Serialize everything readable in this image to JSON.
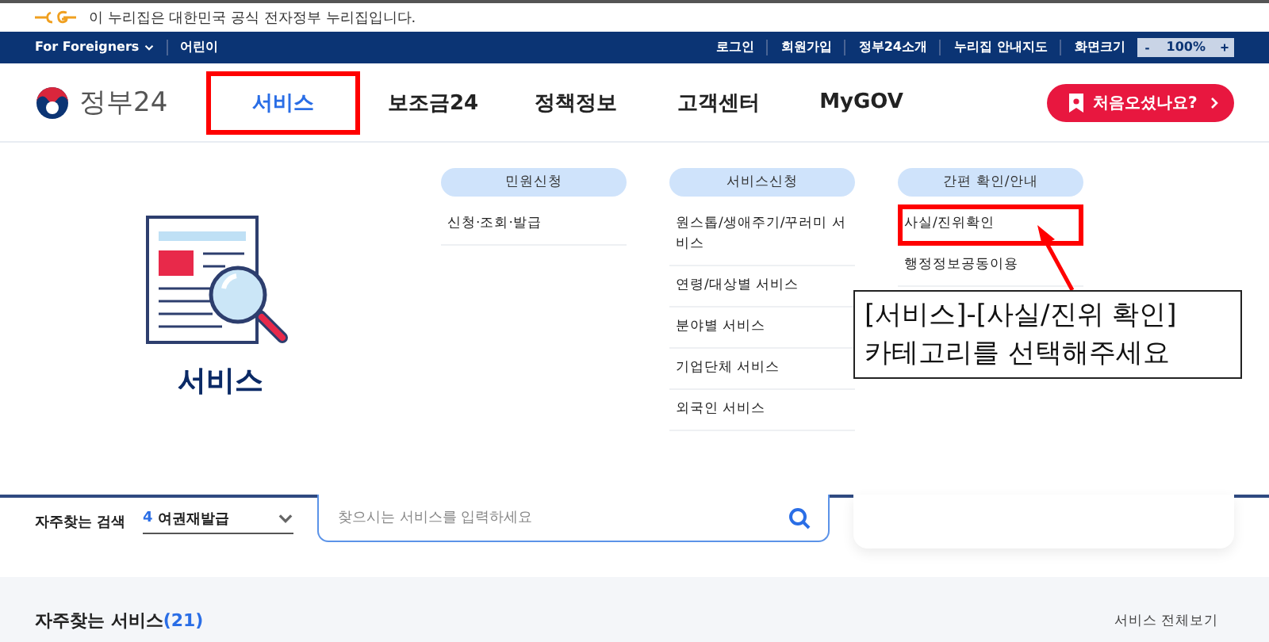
{
  "notice": {
    "text": "이 누리집은 대한민국 공식 전자정부 누리집입니다."
  },
  "utility_bar": {
    "left": [
      {
        "label": "For Foreigners",
        "dropdown": true
      },
      {
        "label": "어린이",
        "dropdown": false
      }
    ],
    "right": [
      "로그인",
      "회원가입",
      "정부24소개",
      "누리집 안내지도"
    ],
    "zoom": {
      "label": "화면크기",
      "decrease": "-",
      "value": "100%",
      "increase": "+"
    }
  },
  "header": {
    "logo": "정부24",
    "nav": [
      {
        "label": "서비스",
        "selected": true,
        "highlighted": true
      },
      {
        "label": "보조금24",
        "selected": false,
        "highlighted": false
      },
      {
        "label": "정책정보",
        "selected": false,
        "highlighted": false
      },
      {
        "label": "고객센터",
        "selected": false,
        "highlighted": false
      },
      {
        "label": "MyGOV",
        "selected": false,
        "highlighted": false
      }
    ],
    "cta": "처음오셨나요?"
  },
  "mega_menu": {
    "title": "서비스",
    "columns": [
      {
        "heading": "민원신청",
        "items": [
          {
            "label": "신청·조회·발급",
            "highlighted": false
          }
        ]
      },
      {
        "heading": "서비스신청",
        "items": [
          {
            "label": "원스톱/생애주기/꾸러미 서비스",
            "highlighted": false
          },
          {
            "label": "연령/대상별 서비스",
            "highlighted": false
          },
          {
            "label": "분야별 서비스",
            "highlighted": false
          },
          {
            "label": "기업단체 서비스",
            "highlighted": false
          },
          {
            "label": "외국인 서비스",
            "highlighted": false
          }
        ]
      },
      {
        "heading": "간편 확인/안내",
        "items": [
          {
            "label": "사실/진위확인",
            "highlighted": true
          },
          {
            "label": "행정정보공동이용",
            "highlighted": false
          }
        ]
      }
    ]
  },
  "callout": {
    "lines": [
      "[서비스]-[사실/진위 확인]",
      "카테고리를 선택해주세요"
    ]
  },
  "search": {
    "label": "자주찾는 검색",
    "rank": "4",
    "keyword": "여권재발급",
    "placeholder": "찾으시는 서비스를 입력하세요"
  },
  "popular": {
    "title": "자주찾는 서비스",
    "count": "(21)",
    "view_all": "서비스 전체보기"
  }
}
